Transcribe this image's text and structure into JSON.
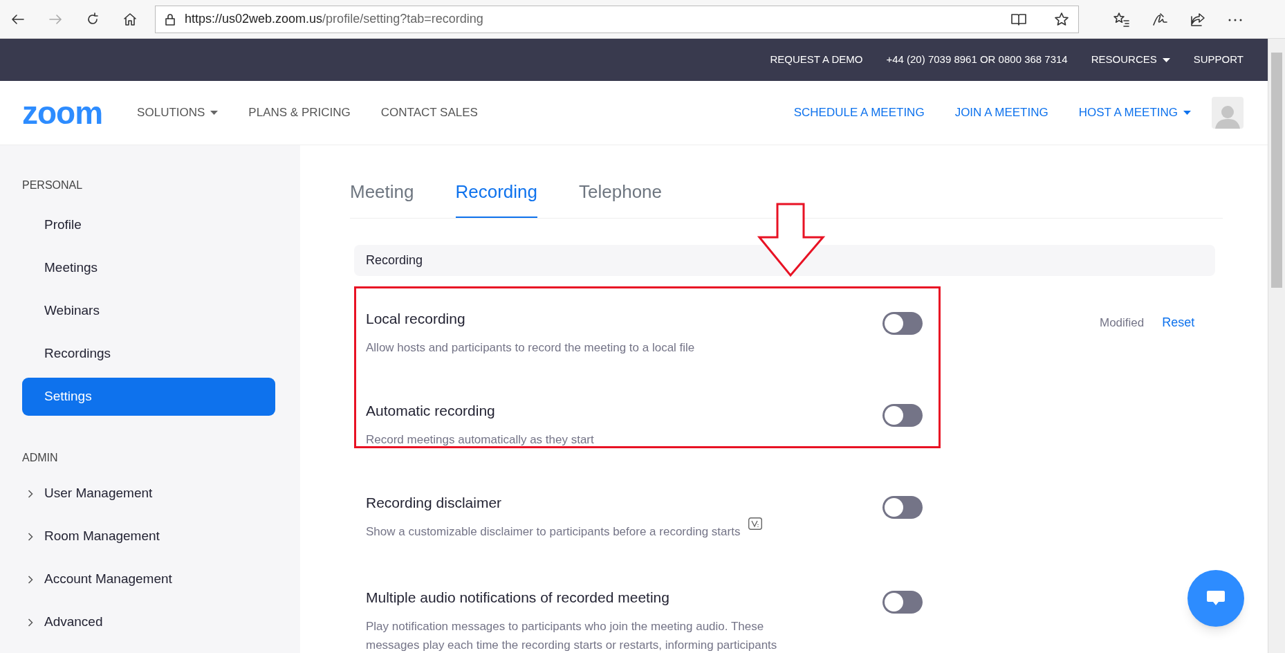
{
  "browser": {
    "url_host": "https://us02web.zoom.us",
    "url_path": "/profile/setting?tab=recording"
  },
  "top_bar": {
    "links": [
      {
        "label": "REQUEST A DEMO",
        "dropdown": false
      },
      {
        "label": "+44 (20) 7039 8961 OR 0800 368 7314",
        "dropdown": false
      },
      {
        "label": "RESOURCES",
        "dropdown": true
      },
      {
        "label": "SUPPORT",
        "dropdown": false
      }
    ]
  },
  "nav": {
    "logo": "zoom",
    "left": [
      {
        "label": "SOLUTIONS",
        "dropdown": true
      },
      {
        "label": "PLANS & PRICING",
        "dropdown": false
      },
      {
        "label": "CONTACT SALES",
        "dropdown": false
      }
    ],
    "right": [
      {
        "label": "SCHEDULE A MEETING",
        "dropdown": false
      },
      {
        "label": "JOIN A MEETING",
        "dropdown": false
      },
      {
        "label": "HOST A MEETING",
        "dropdown": true
      }
    ]
  },
  "sidebar": {
    "sections": [
      {
        "title": "PERSONAL",
        "items": [
          {
            "label": "Profile",
            "selected": false,
            "expandable": false
          },
          {
            "label": "Meetings",
            "selected": false,
            "expandable": false
          },
          {
            "label": "Webinars",
            "selected": false,
            "expandable": false
          },
          {
            "label": "Recordings",
            "selected": false,
            "expandable": false
          },
          {
            "label": "Settings",
            "selected": true,
            "expandable": false
          }
        ]
      },
      {
        "title": "ADMIN",
        "items": [
          {
            "label": "User Management",
            "selected": false,
            "expandable": true
          },
          {
            "label": "Room Management",
            "selected": false,
            "expandable": true
          },
          {
            "label": "Account Management",
            "selected": false,
            "expandable": true
          },
          {
            "label": "Advanced",
            "selected": false,
            "expandable": true
          }
        ]
      }
    ]
  },
  "tabs": [
    {
      "label": "Meeting",
      "selected": false
    },
    {
      "label": "Recording",
      "selected": true
    },
    {
      "label": "Telephone",
      "selected": false
    }
  ],
  "section_title": "Recording",
  "settings": [
    {
      "title": "Local recording",
      "description": [
        "Allow hosts and participants to record the meeting to a local file"
      ],
      "on": false,
      "highlighted": true,
      "variable_icon": false,
      "modified": "Modified",
      "reset": "Reset"
    },
    {
      "title": "Automatic recording",
      "description": [
        "Record meetings automatically as they start"
      ],
      "on": false,
      "highlighted": true,
      "variable_icon": false
    },
    {
      "title": "Recording disclaimer",
      "description": [
        "Show a customizable disclaimer to participants before a recording starts"
      ],
      "on": false,
      "highlighted": false,
      "variable_icon": true
    },
    {
      "title": "Multiple audio notifications of recorded meeting",
      "description": [
        "Play notification messages to participants who join the meeting audio. These",
        "messages play each time the recording starts or restarts, informing participants"
      ],
      "on": false,
      "highlighted": false,
      "variable_icon": false
    }
  ]
}
